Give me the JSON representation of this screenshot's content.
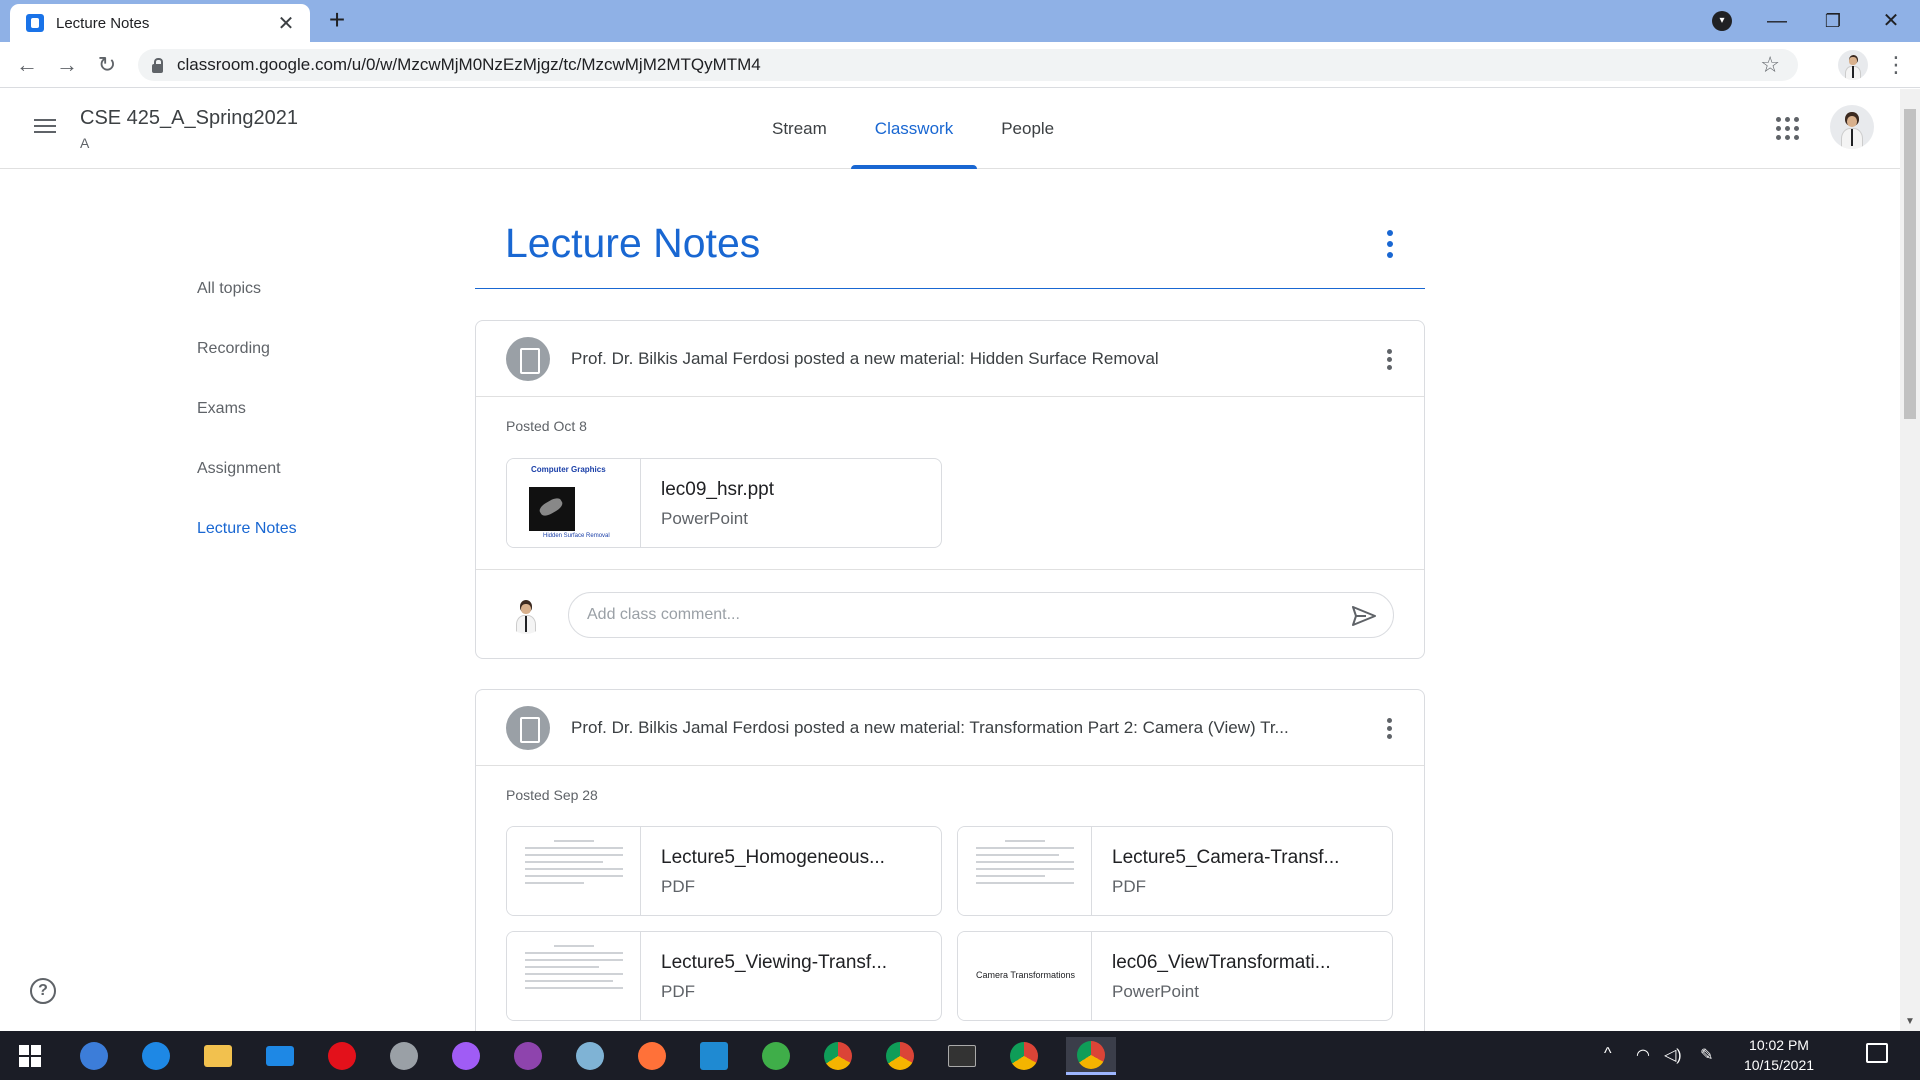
{
  "browser": {
    "tab_title": "Lecture Notes",
    "url": "classroom.google.com/u/0/w/MzcwMjM0NzEzMjgz/tc/MzcwMjM2MTQyMTM4"
  },
  "header": {
    "class_name": "CSE 425_A_Spring2021",
    "section": "A",
    "tabs": [
      {
        "label": "Stream",
        "active": false
      },
      {
        "label": "Classwork",
        "active": true
      },
      {
        "label": "People",
        "active": false
      }
    ]
  },
  "sidebar": {
    "topics": [
      {
        "label": "All topics",
        "active": false
      },
      {
        "label": "Recording",
        "active": false
      },
      {
        "label": "Exams",
        "active": false
      },
      {
        "label": "Assignment",
        "active": false
      },
      {
        "label": "Lecture Notes",
        "active": true
      }
    ]
  },
  "main": {
    "section_title": "Lecture Notes",
    "posts": [
      {
        "title": "Prof. Dr. Bilkis Jamal Ferdosi posted a new material: Hidden Surface Removal",
        "posted": "Posted Oct 8",
        "attachments": [
          {
            "name": "lec09_hsr.ppt",
            "type": "PowerPoint",
            "thumb_title": "Computer Graphics",
            "thumb_sub": "Hidden Surface Removal"
          }
        ],
        "comment_placeholder": "Add class comment..."
      },
      {
        "title": "Prof. Dr. Bilkis Jamal Ferdosi posted a new material: Transformation Part 2: Camera (View) Tr...",
        "posted": "Posted Sep 28",
        "attachments": [
          {
            "name": "Lecture5_Homogeneous...",
            "type": "PDF"
          },
          {
            "name": "Lecture5_Camera-Transf...",
            "type": "PDF"
          },
          {
            "name": "Lecture5_Viewing-Transf...",
            "type": "PDF"
          },
          {
            "name": "lec06_ViewTransformati...",
            "type": "PowerPoint",
            "thumb_title": "Camera Transformations"
          }
        ]
      }
    ]
  },
  "taskbar": {
    "time": "10:02 PM",
    "date": "10/15/2021"
  },
  "colors": {
    "accent": "#1967d2",
    "tabbar": "#8fb1e6",
    "taskbar": "#1b1d26"
  }
}
